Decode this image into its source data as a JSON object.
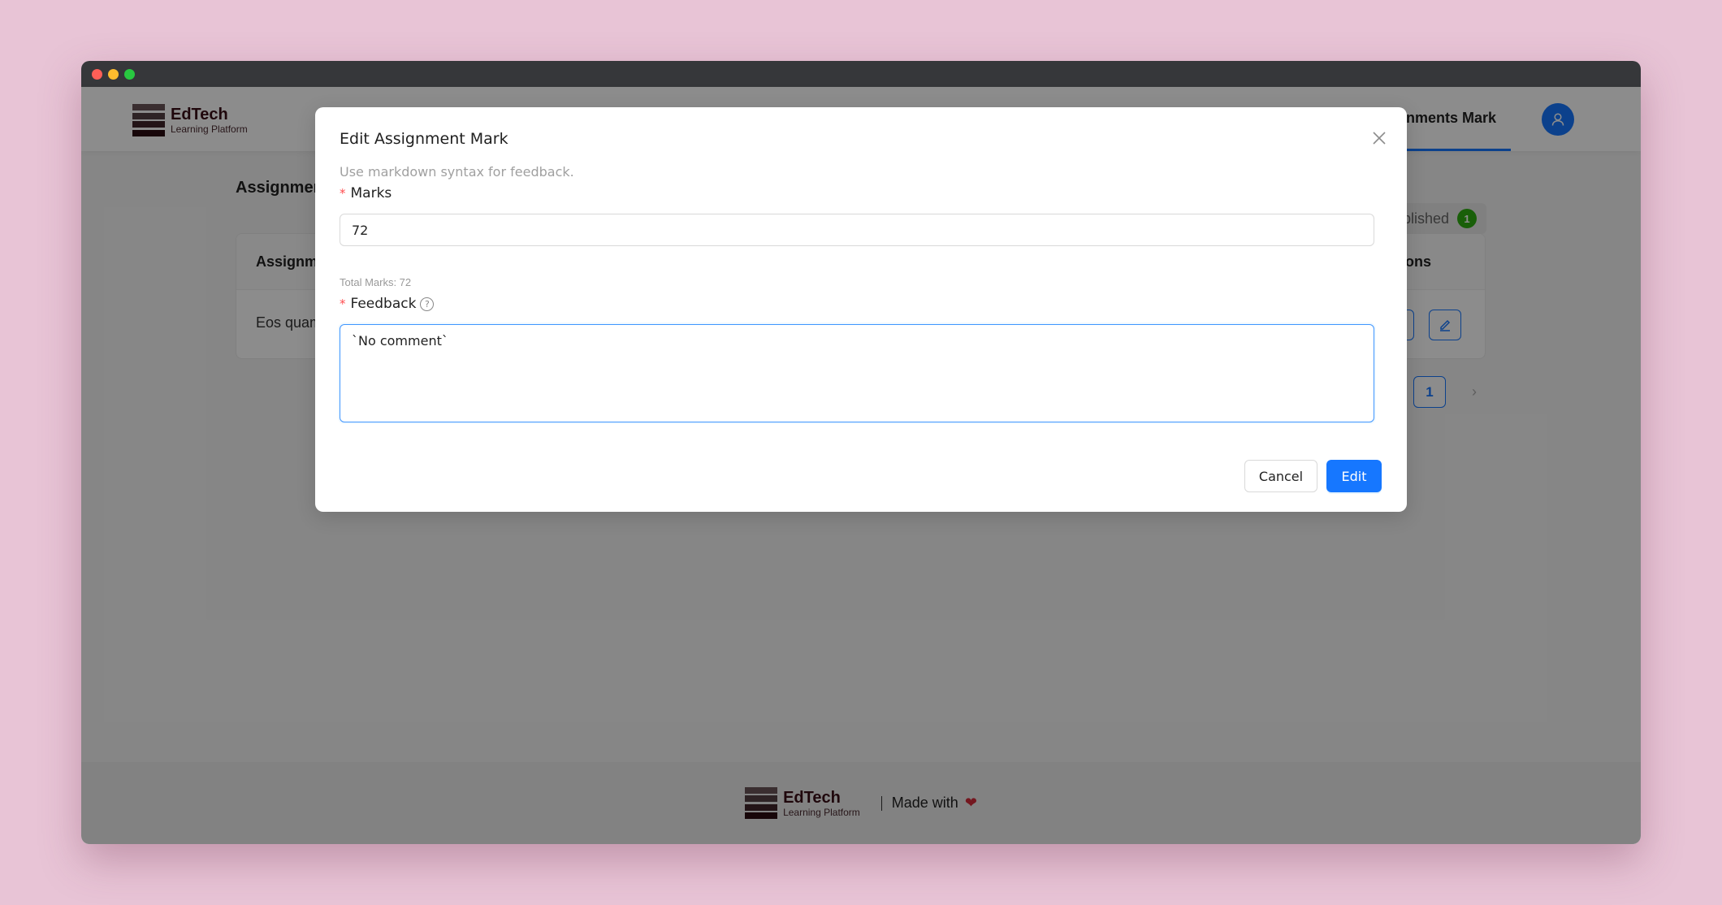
{
  "app": {
    "brand_name": "EdTech",
    "brand_subtitle": "Learning Platform",
    "logo_colors": [
      "#6b5558",
      "#554044",
      "#40262b",
      "#2a0c12"
    ]
  },
  "navbar": {
    "active_tab": "Assignments Mark",
    "avatar_icon": "user-icon"
  },
  "page": {
    "title": "Assignments Mark",
    "filter": {
      "label": "Published",
      "count": "1",
      "badge_color": "#2fae12"
    },
    "table": {
      "columns": [
        "Assignment",
        "Actions"
      ],
      "rows": [
        {
          "assignment": "Eos quam",
          "actions": [
            "view",
            "edit"
          ]
        }
      ]
    },
    "pagination": {
      "current_page": "1",
      "next_icon": "chevron-right-icon"
    }
  },
  "footer": {
    "brand_name": "EdTech",
    "brand_subtitle": "Learning Platform",
    "made_with": "Made with",
    "heart": "❤"
  },
  "modal": {
    "title": "Edit Assignment Mark",
    "hint": "Use markdown syntax for feedback.",
    "marks_label": "Marks",
    "marks_value": "72",
    "total_marks": "Total Marks: 72",
    "feedback_label": "Feedback",
    "feedback_value": "`No comment`",
    "cancel_label": "Cancel",
    "submit_label": "Edit"
  },
  "colors": {
    "primary": "#1677ff",
    "required": "#ff4d4f"
  }
}
